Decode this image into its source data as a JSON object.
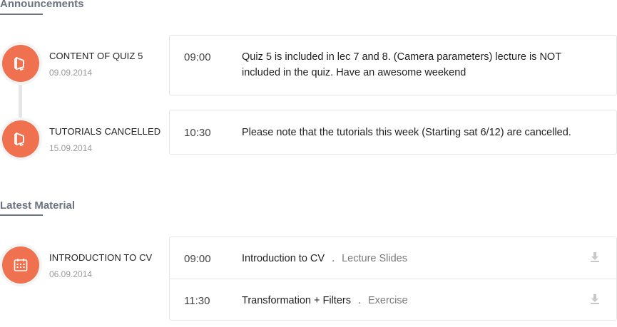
{
  "announcements": {
    "title": "Announcements",
    "items": [
      {
        "title": "CONTENT OF QUIZ 5",
        "date": "09.09.2014",
        "time": "09:00",
        "message": "Quiz 5 is included in lec 7 and 8. (Camera parameters) lecture is NOT included in the quiz. Have an awesome weekend"
      },
      {
        "title": "TUTORIALS CANCELLED",
        "date": "15.09.2014",
        "time": "10:30",
        "message": "Please note that the tutorials this week (Starting sat 6/12) are cancelled."
      }
    ]
  },
  "materials": {
    "title": "Latest Material",
    "items": [
      {
        "title": "INTRODUCTION TO CV",
        "date": "06.09.2014",
        "rows": [
          {
            "time": "09:00",
            "name": "Introduction to CV",
            "separator": ".",
            "type": "Lecture Slides"
          },
          {
            "time": "11:30",
            "name": "Transformation + Filters",
            "separator": ".",
            "type": "Exercise"
          }
        ]
      }
    ]
  },
  "colors": {
    "accent": "#f0714f",
    "section_title": "#6b7280",
    "border": "#e5e5e5"
  },
  "icons": {
    "announcement": "megaphone-icon",
    "material": "calendar-icon",
    "download": "download-icon"
  }
}
